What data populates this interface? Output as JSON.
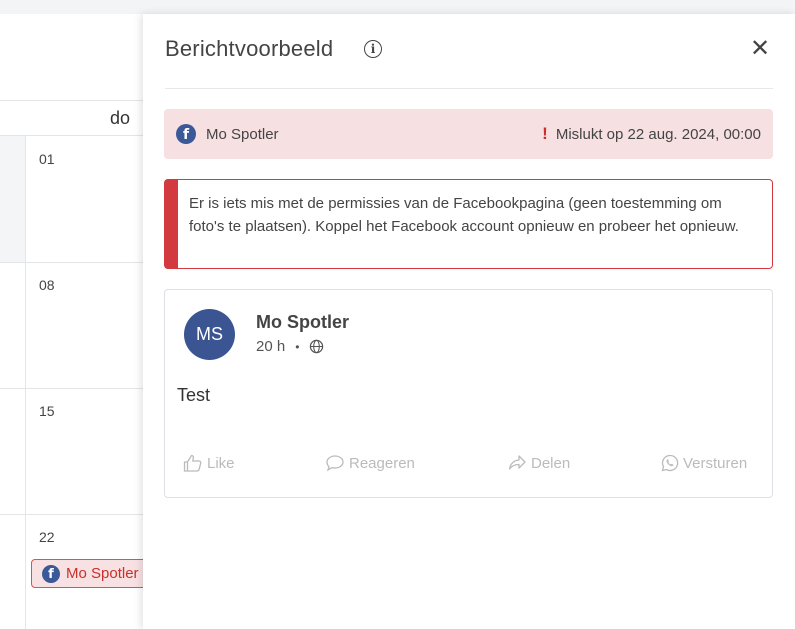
{
  "calendar": {
    "day_of_week": "do",
    "dates": [
      "01",
      "08",
      "15",
      "22"
    ],
    "event": {
      "icon": "facebook-icon",
      "label": "Mo Spotler"
    }
  },
  "panel": {
    "title": "Berichtvoorbeeld",
    "info_icon": "i",
    "close_icon": "✕",
    "status": {
      "platform_icon": "facebook-icon",
      "account": "Mo Spotler",
      "alert_icon": "!",
      "status_text": "Mislukt op 22 aug. 2024, 00:00",
      "status_color": "#c9302c"
    },
    "error_message": "Er is iets mis met de permissies van de Facebookpagina (geen toestemming om foto's te plaatsen). Koppel het Facebook account opnieuw en probeer het opnieuw.",
    "post": {
      "avatar_initials": "MS",
      "author": "Mo Spotler",
      "time": "20 h",
      "separator": "•",
      "body": "Test",
      "actions": {
        "like": "Like",
        "comment": "Reageren",
        "share": "Delen",
        "send": "Versturen"
      }
    }
  },
  "colors": {
    "facebook_blue": "#3b5998",
    "error_red": "#d33a3f",
    "status_bg": "#f6e0e2"
  }
}
